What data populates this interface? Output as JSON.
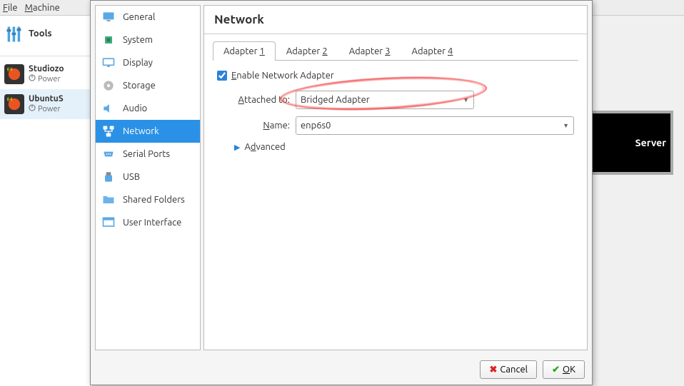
{
  "menubar": {
    "file": "File",
    "machine": "Machine"
  },
  "tools_label": "Tools",
  "vms": [
    {
      "name": "Studiozo",
      "status": "Power"
    },
    {
      "name": "UbuntuS",
      "status": "Power"
    }
  ],
  "preview_label": "Server",
  "categories": [
    {
      "id": "general",
      "label": "General"
    },
    {
      "id": "system",
      "label": "System"
    },
    {
      "id": "display",
      "label": "Display"
    },
    {
      "id": "storage",
      "label": "Storage"
    },
    {
      "id": "audio",
      "label": "Audio"
    },
    {
      "id": "network",
      "label": "Network",
      "selected": true
    },
    {
      "id": "serial",
      "label": "Serial Ports"
    },
    {
      "id": "usb",
      "label": "USB"
    },
    {
      "id": "shared",
      "label": "Shared Folders"
    },
    {
      "id": "ui",
      "label": "User Interface"
    }
  ],
  "panel_title": "Network",
  "tabs": [
    {
      "label": "Adapter 1",
      "accel": "1",
      "active": true
    },
    {
      "label": "Adapter 2",
      "accel": "2"
    },
    {
      "label": "Adapter 3",
      "accel": "3"
    },
    {
      "label": "Adapter 4",
      "accel": "4"
    }
  ],
  "form": {
    "enable_label": "Enable Network Adapter",
    "enable_accel": "E",
    "enable_checked": true,
    "attached_label": "Attached to:",
    "attached_accel": "A",
    "attached_value": "Bridged Adapter",
    "name_label": "Name:",
    "name_accel": "N",
    "name_value": "enp6s0",
    "advanced_label": "Advanced",
    "advanced_accel": "d"
  },
  "buttons": {
    "cancel": "Cancel",
    "ok": "OK"
  }
}
